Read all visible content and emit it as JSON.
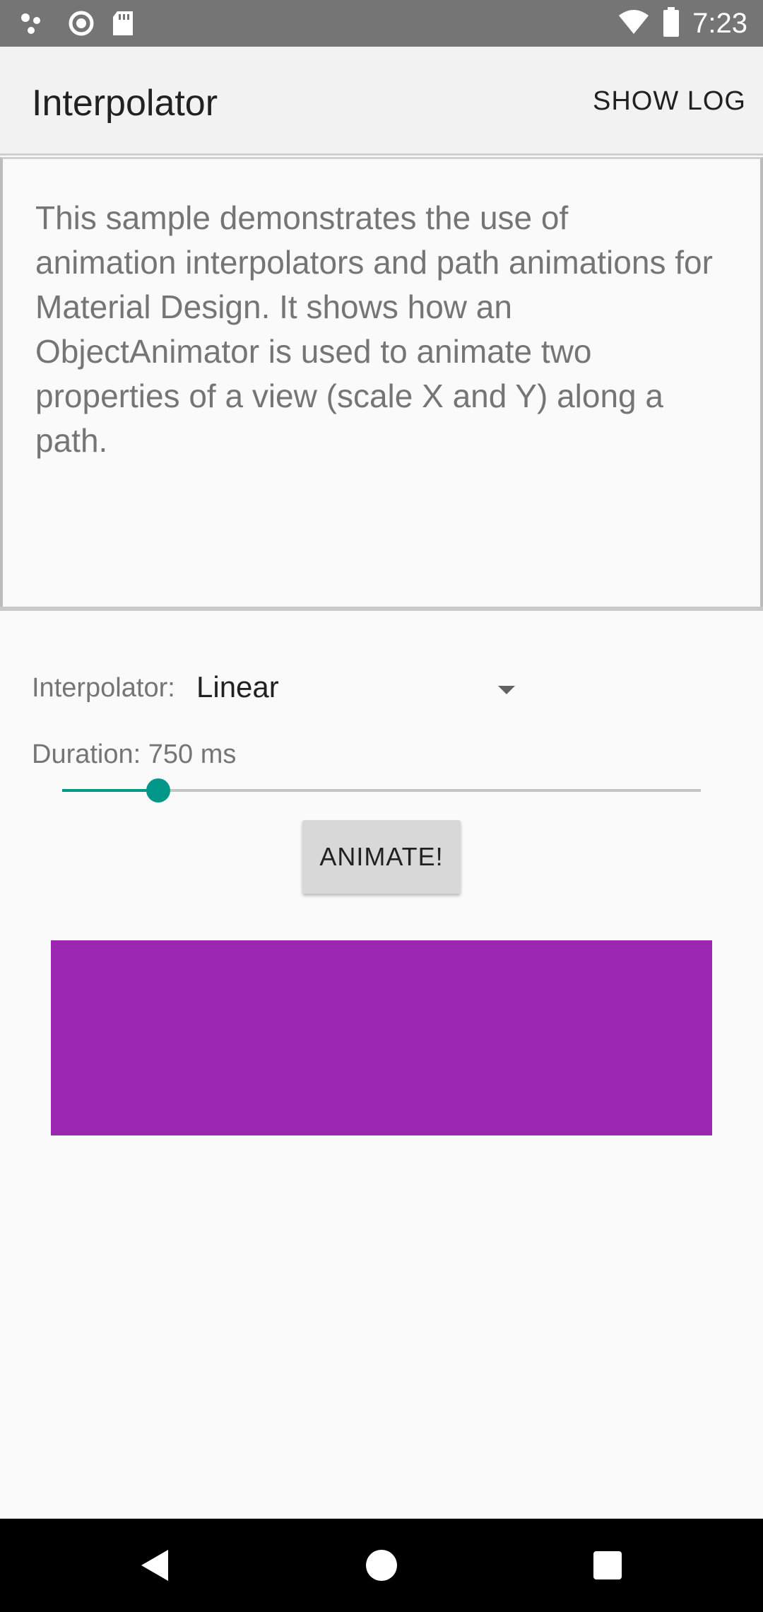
{
  "status_bar": {
    "time": "7:23",
    "icons_left": [
      "notification-dots-icon",
      "sync-circle-icon",
      "sd-card-icon"
    ],
    "icons_right": [
      "wifi-icon",
      "battery-icon"
    ]
  },
  "app_bar": {
    "title": "Interpolator",
    "show_log_label": "SHOW LOG"
  },
  "description": {
    "text": "This sample demonstrates the use of animation interpolators and path animations for Material Design. It shows how an ObjectAnimator is used to animate two properties of a view (scale X and Y) along a path."
  },
  "controls": {
    "interpolator_label": "Interpolator:",
    "interpolator_value": "Linear",
    "duration_label": "Duration: 750 ms",
    "duration_slider_fraction": 0.15,
    "animate_label": "ANIMATE!"
  },
  "colors": {
    "accent": "#009688",
    "animated_view": "#9c27b0",
    "status_bar": "#757575",
    "app_bar": "#f2f2f2"
  },
  "nav_bar": {
    "icons": [
      "back-icon",
      "home-icon",
      "recents-icon"
    ]
  }
}
